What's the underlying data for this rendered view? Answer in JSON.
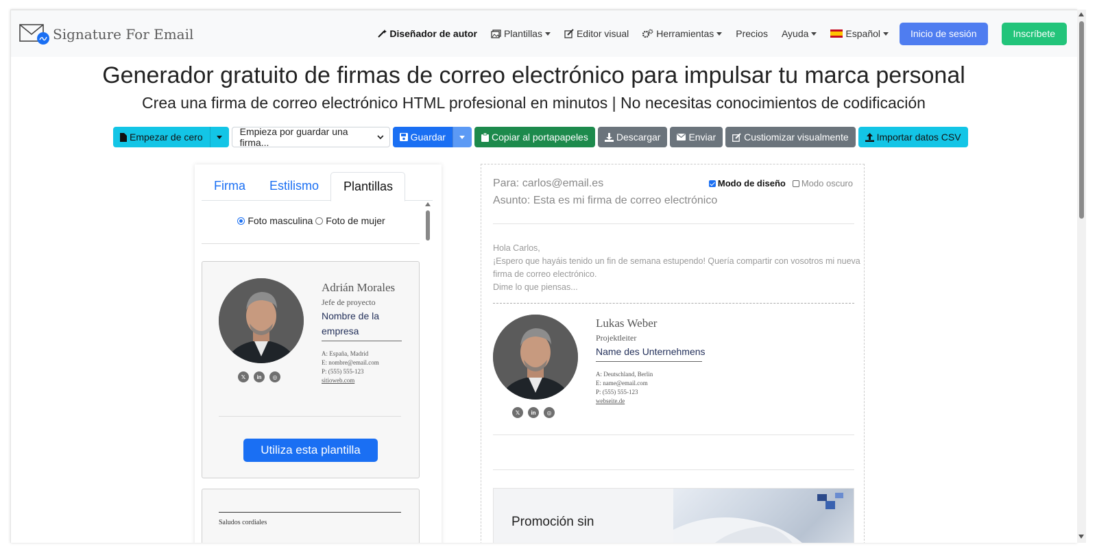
{
  "brand": {
    "name": "Signature For Email",
    "icon": "envelope-signature-logo"
  },
  "nav": {
    "designer": "Diseñador de autor",
    "templates": "Plantillas",
    "visual_editor": "Editor visual",
    "tools": "Herramientas",
    "pricing": "Precios",
    "help": "Ayuda",
    "language": "Español",
    "login": "Inicio de sesión",
    "signup": "Inscríbete"
  },
  "hero": {
    "title": "Generador gratuito de firmas de correo electrónico para impulsar tu marca personal",
    "subtitle": "Crea una firma de correo electrónico HTML profesional en minutos | No necesitas conocimientos de codificación"
  },
  "toolbar": {
    "start_from_scratch": "Empezar de cero",
    "select_placeholder": "Empieza por guardar una firma...",
    "save": "Guardar",
    "copy_clipboard": "Copiar al portapapeles",
    "download": "Descargar",
    "send": "Enviar",
    "customize_visually": "Custiomizar visualmente",
    "import_csv": "Importar datos CSV"
  },
  "left_panel": {
    "tabs": [
      "Firma",
      "Estilismo",
      "Plantillas"
    ],
    "active_tab": "Plantillas",
    "photo_options": [
      "Foto masculina",
      "Foto de mujer"
    ],
    "selected_photo": "Foto masculina",
    "template_card": {
      "name": "Adrián Morales",
      "role": "Jefe de proyecto",
      "company": "Nombre de la empresa",
      "address": "A: España, Madrid",
      "email": "E: nombre@email.com",
      "phone": "P: (555) 555-123",
      "website": "sitioweb.com",
      "use_button": "Utiliza esta plantilla"
    },
    "template_card2": {
      "closing": "Saludos cordiales"
    }
  },
  "preview": {
    "to": "Para: carlos@email.es",
    "subject": "Asunto: Esta es mi firma de correo electrónico",
    "design_mode": "Modo de diseño",
    "dark_mode": "Modo oscuro",
    "design_mode_checked": true,
    "dark_mode_checked": false,
    "greeting": "Hola Carlos,",
    "body": "¡Espero que hayáis tenido un fin de semana estupendo! Quería compartir con vosotros mi nueva firma de correo electrónico.",
    "closing_line": "Dime lo que piensas...",
    "signature": {
      "name": "Lukas Weber",
      "role": "Projektleiter",
      "company": "Name des Unternehmens",
      "address": "A: Deutschland, Berlin",
      "email": "E: name@email.com",
      "phone": "P: (555) 555-123",
      "website": "webseite.de"
    },
    "promo_title": "Promoción sin"
  },
  "colors": {
    "primary": "#1a6ff3",
    "cyan": "#13c5e6",
    "green": "#1d8a4c",
    "gray": "#6b747c",
    "login": "#4f7df0",
    "signup": "#22c47a"
  }
}
